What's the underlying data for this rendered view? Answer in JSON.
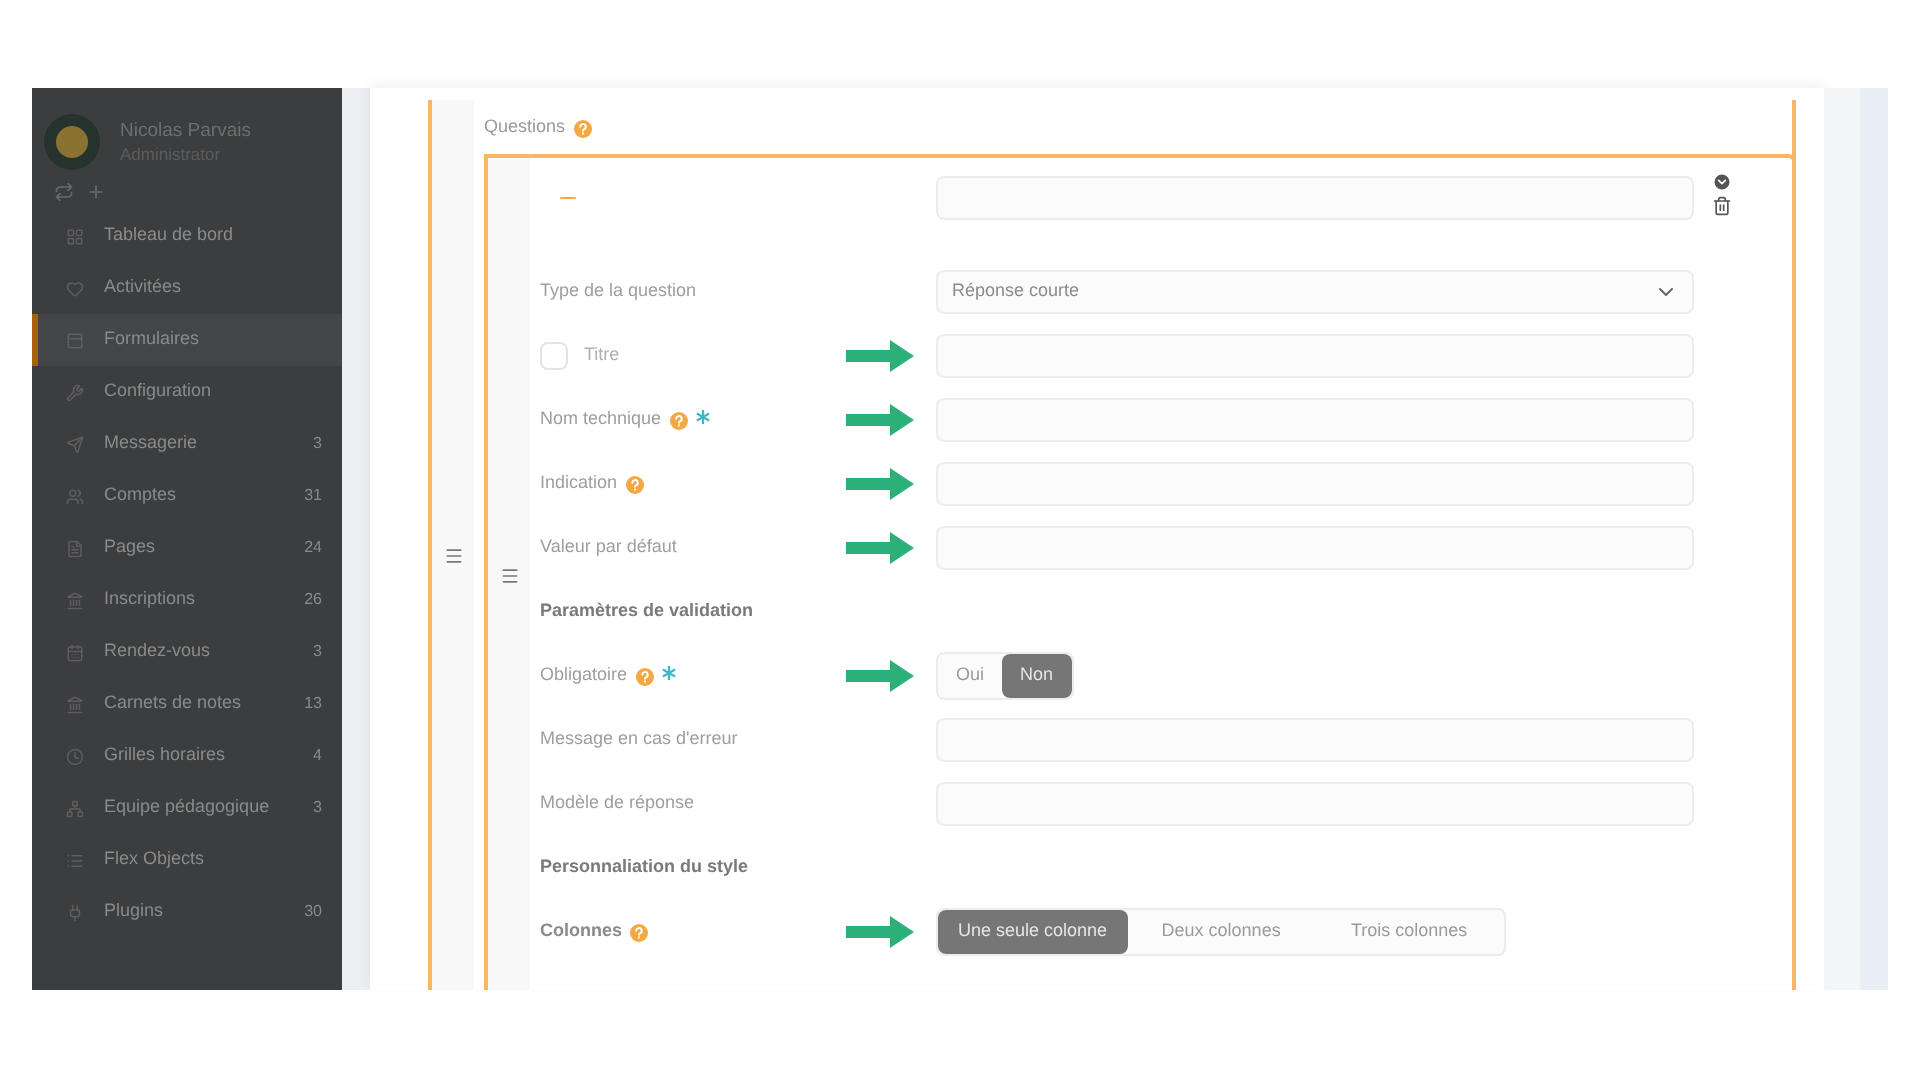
{
  "sidebar": {
    "user": {
      "name": "Nicolas Parvais",
      "role": "Administrator"
    },
    "items": [
      {
        "label": "Tableau de bord",
        "selected": false
      },
      {
        "label": "Activitées",
        "selected": false
      },
      {
        "label": "Formulaires",
        "selected": true
      },
      {
        "label": "Configuration",
        "selected": false
      },
      {
        "label": "Messagerie",
        "count": "3",
        "selected": false
      },
      {
        "label": "Comptes",
        "count": "31",
        "selected": false
      },
      {
        "label": "Pages",
        "count": "24",
        "selected": false
      },
      {
        "label": "Inscriptions",
        "count": "26",
        "selected": false
      },
      {
        "label": "Rendez-vous",
        "count": "3",
        "selected": false
      },
      {
        "label": "Carnets de notes",
        "count": "13",
        "selected": false
      },
      {
        "label": "Grilles horaires",
        "count": "4",
        "selected": false
      },
      {
        "label": "Equipe pédagogique",
        "count": "3",
        "selected": false
      },
      {
        "label": "Flex Objects",
        "selected": false
      },
      {
        "label": "Plugins",
        "count": "30",
        "selected": false
      }
    ]
  },
  "form": {
    "section_label": "Questions",
    "section_help": true,
    "rows": [
      {
        "kind": "select",
        "label": "Type de la question",
        "value": "Réponse courte",
        "arrow": false
      },
      {
        "kind": "checkbox",
        "label": "Titre",
        "checked": false,
        "arrow": true
      },
      {
        "kind": "input",
        "label": "Nom technique",
        "help": true,
        "required": true,
        "arrow": true
      },
      {
        "kind": "input",
        "label": "Indication",
        "help": true,
        "required": false,
        "arrow": true
      },
      {
        "kind": "input",
        "label": "Valeur par défaut",
        "help": false,
        "required": false,
        "arrow": true
      },
      {
        "kind": "section",
        "label": "Paramètres de validation"
      },
      {
        "kind": "toggle",
        "label": "Obligatoire",
        "help": true,
        "required": true,
        "arrow": true,
        "options": [
          {
            "label": "Oui",
            "selected": false
          },
          {
            "label": "Non",
            "selected": true
          }
        ]
      },
      {
        "kind": "input",
        "label": "Message en cas d'erreur",
        "help": false,
        "required": false,
        "arrow": false
      },
      {
        "kind": "input",
        "label": "Modèle de réponse",
        "help": false,
        "required": false,
        "arrow": false
      },
      {
        "kind": "section",
        "label": "Personnaliation du style"
      },
      {
        "kind": "segmented",
        "label": "Colonnes",
        "help": true,
        "required": false,
        "arrow": true,
        "options": [
          {
            "label": "Une seule colonne",
            "selected": true
          },
          {
            "label": "Deux colonnes",
            "selected": false
          },
          {
            "label": "Trois colonnes",
            "selected": false
          }
        ]
      }
    ]
  }
}
